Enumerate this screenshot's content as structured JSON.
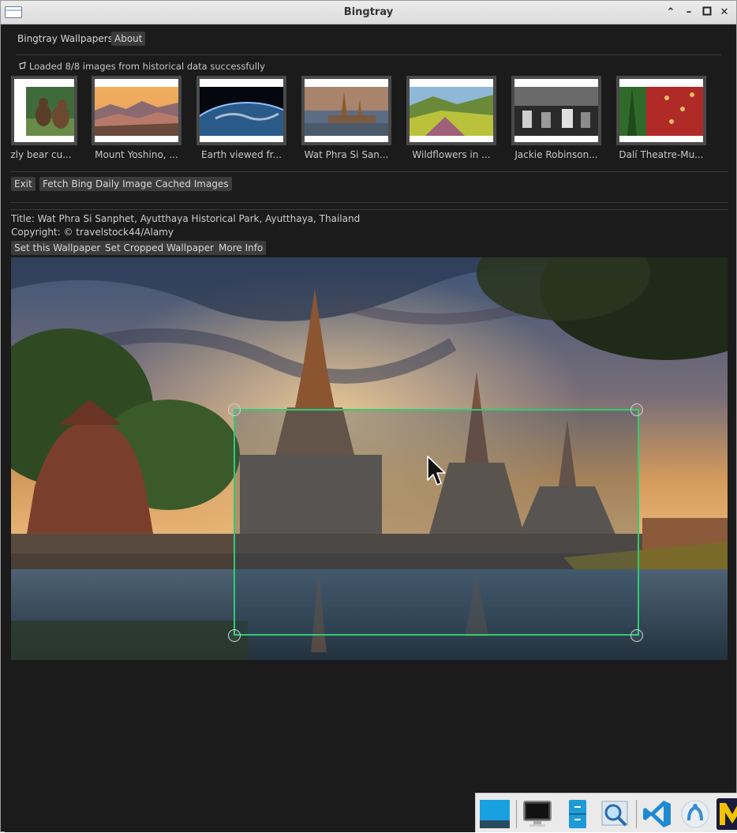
{
  "window": {
    "title": "Bingtray"
  },
  "menu": {
    "app_label": "Bingtray Wallpapers",
    "about_label": "About"
  },
  "status": {
    "message": "Loaded 8/8 images from historical data successfully"
  },
  "thumbnails": [
    {
      "caption": "zly bear cu...",
      "icon": "grizzly-bear-thumbnail"
    },
    {
      "caption": "Mount Yoshino, ...",
      "icon": "mount-yoshino-thumbnail"
    },
    {
      "caption": "Earth viewed fr...",
      "icon": "earth-thumbnail"
    },
    {
      "caption": "Wat Phra Si San...",
      "icon": "wat-phra-si-sanphet-thumbnail"
    },
    {
      "caption": "Wildflowers in ...",
      "icon": "wildflowers-thumbnail"
    },
    {
      "caption": "Jackie Robinson...",
      "icon": "jackie-robinson-thumbnail"
    },
    {
      "caption": "Dalí Theatre-Mu...",
      "icon": "dali-theatre-thumbnail"
    }
  ],
  "actions": {
    "exit_label": "Exit",
    "fetch_label": "Fetch Bing Daily Image",
    "cached_label": "Cached Images"
  },
  "details": {
    "title_line": "Title: Wat Phra Si Sanphet, Ayutthaya Historical Park, Ayutthaya, Thailand",
    "copyright_line": "Copyright: © travelstock44/Alamy",
    "set_wallpaper_label": "Set this Wallpaper",
    "set_cropped_label": "Set Cropped Wallpaper",
    "more_info_label": "More Info"
  },
  "preview": {
    "crop_color": "#2ecc71"
  },
  "taskbar": {
    "items": [
      "show-desktop-icon",
      "display-settings-icon",
      "file-manager-icon",
      "search-tool-icon",
      "vscode-icon",
      "kde-connect-icon",
      "app-m-icon"
    ]
  }
}
